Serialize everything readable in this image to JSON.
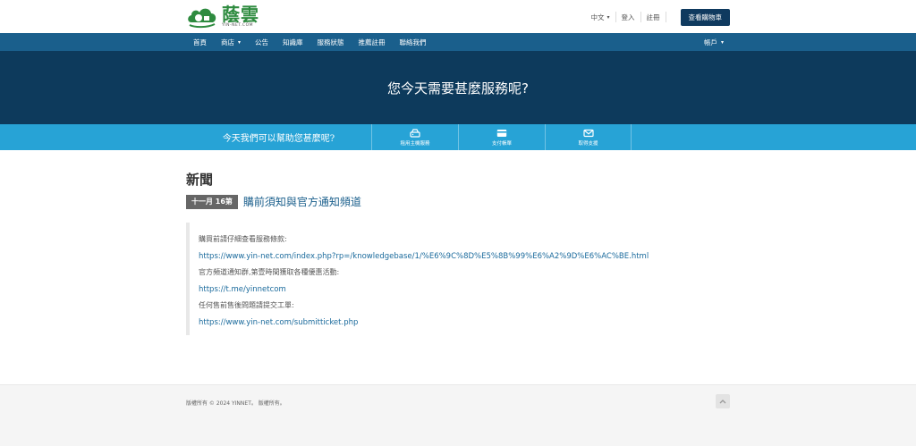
{
  "header": {
    "logo_title": "蔭雲",
    "logo_subtitle": "YIN-NET.COM",
    "language": "中文",
    "login": "登入",
    "register": "註冊",
    "cart_button": "查看購物車"
  },
  "nav": {
    "items": [
      {
        "label": "首頁"
      },
      {
        "label": "商店"
      },
      {
        "label": "公告"
      },
      {
        "label": "知識庫"
      },
      {
        "label": "服務狀態"
      },
      {
        "label": "推薦註冊"
      },
      {
        "label": "聯絡我們"
      }
    ],
    "account": "帳戶"
  },
  "hero": {
    "title": "您今天需要甚麼服務呢?"
  },
  "help": {
    "question": "今天我們可以幫助您甚麼呢?",
    "buttons": [
      {
        "label": "租用主機服務",
        "icon": "server-icon"
      },
      {
        "label": "支付帳單",
        "icon": "credit-card-icon"
      },
      {
        "label": "取得支援",
        "icon": "envelope-icon"
      }
    ]
  },
  "main": {
    "page_title": "新聞",
    "date_badge": "十一月 16第",
    "news_title": "購前須知與官方通知頻道",
    "lines": [
      "購買前請仔細查看服務條款:",
      "https://www.yin-net.com/index.php?rp=/knowledgebase/1/%E6%9C%8D%E5%8B%99%E6%A2%9D%E6%AC%BE.html",
      "官方頻道通知群,第壹時間獲取各種優惠活動:",
      "https://t.me/yinnetcom",
      "任何售前售後問題請提交工單:",
      "https://www.yin-net.com/submitticket.php"
    ]
  },
  "footer": {
    "copyright": "版權所有 © 2024 YINNET。 版權所有。"
  },
  "colors": {
    "nav_bg": "#1a5f8c",
    "hero_bg": "#0d3a5c",
    "help_bg": "#27a3d6",
    "cart_btn": "#0f3a5f",
    "link": "#1a6a9c"
  }
}
